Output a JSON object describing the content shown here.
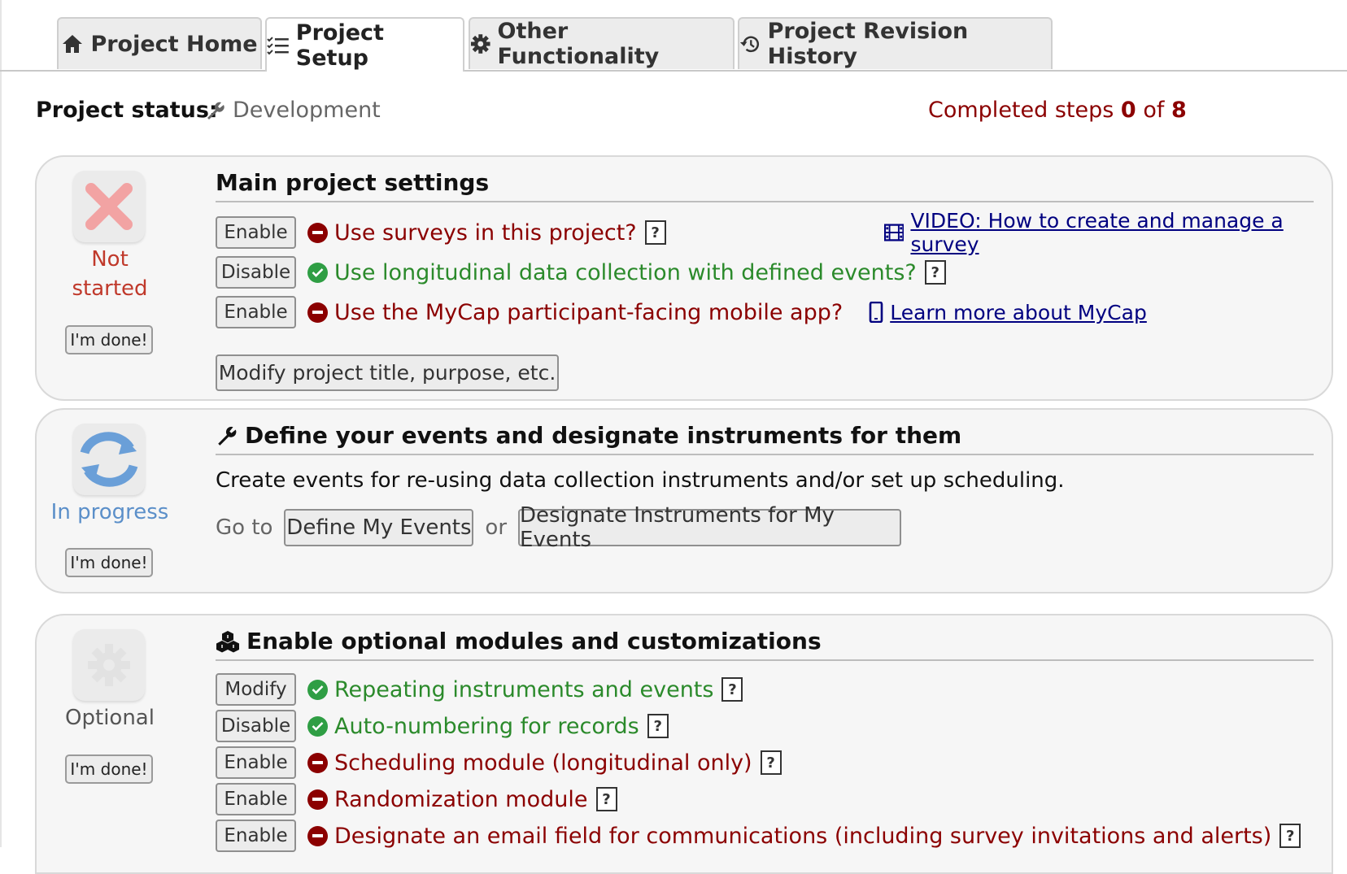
{
  "tabs": [
    {
      "label": "Project Home",
      "icon": "home-icon"
    },
    {
      "label": "Project Setup",
      "icon": "checklist-icon"
    },
    {
      "label": "Other Functionality",
      "icon": "gear-icon"
    },
    {
      "label": "Project Revision History",
      "icon": "history-icon"
    }
  ],
  "status": {
    "label": "Project status:",
    "value": "Development",
    "completed_prefix": "Completed steps",
    "completed_count": "0",
    "completed_of": "of",
    "completed_total": "8"
  },
  "steps": [
    {
      "title": "Main project settings",
      "status": "Not started",
      "done_label": "I'm done!",
      "rows": [
        {
          "button": "Enable",
          "state": "off",
          "text": "Use surveys in this project?",
          "help": "?",
          "link": "VIDEO: How to create and manage a survey"
        },
        {
          "button": "Disable",
          "state": "on",
          "text": "Use longitudinal data collection with defined events?",
          "help": "?"
        },
        {
          "button": "Enable",
          "state": "off",
          "text": "Use the MyCap participant-facing mobile app?",
          "link": "Learn more about MyCap"
        }
      ],
      "modify_button": "Modify project title, purpose, etc."
    },
    {
      "title": "Define your events and designate instruments for them",
      "status": "In progress",
      "done_label": "I'm done!",
      "description": "Create events for re-using data collection instruments and/or set up scheduling.",
      "goto": "Go to",
      "button1": "Define My Events",
      "or": "or",
      "button2": "Designate Instruments for My Events"
    },
    {
      "title": "Enable optional modules and customizations",
      "status": "Optional",
      "done_label": "I'm done!",
      "rows": [
        {
          "button": "Modify",
          "state": "on",
          "text": "Repeating instruments and events",
          "help": "?"
        },
        {
          "button": "Disable",
          "state": "on",
          "text": "Auto-numbering for records",
          "help": "?"
        },
        {
          "button": "Enable",
          "state": "off",
          "text": "Scheduling module (longitudinal only)",
          "help": "?"
        },
        {
          "button": "Enable",
          "state": "off",
          "text": "Randomization module",
          "help": "?"
        },
        {
          "button": "Enable",
          "state": "off",
          "text": "Designate an email field for communications (including survey invitations and alerts)",
          "help": "?"
        }
      ]
    }
  ],
  "colors": {
    "red": "#8b0000",
    "green": "#2b8a2b",
    "link": "#000080",
    "progress": "#5b8fc9"
  }
}
